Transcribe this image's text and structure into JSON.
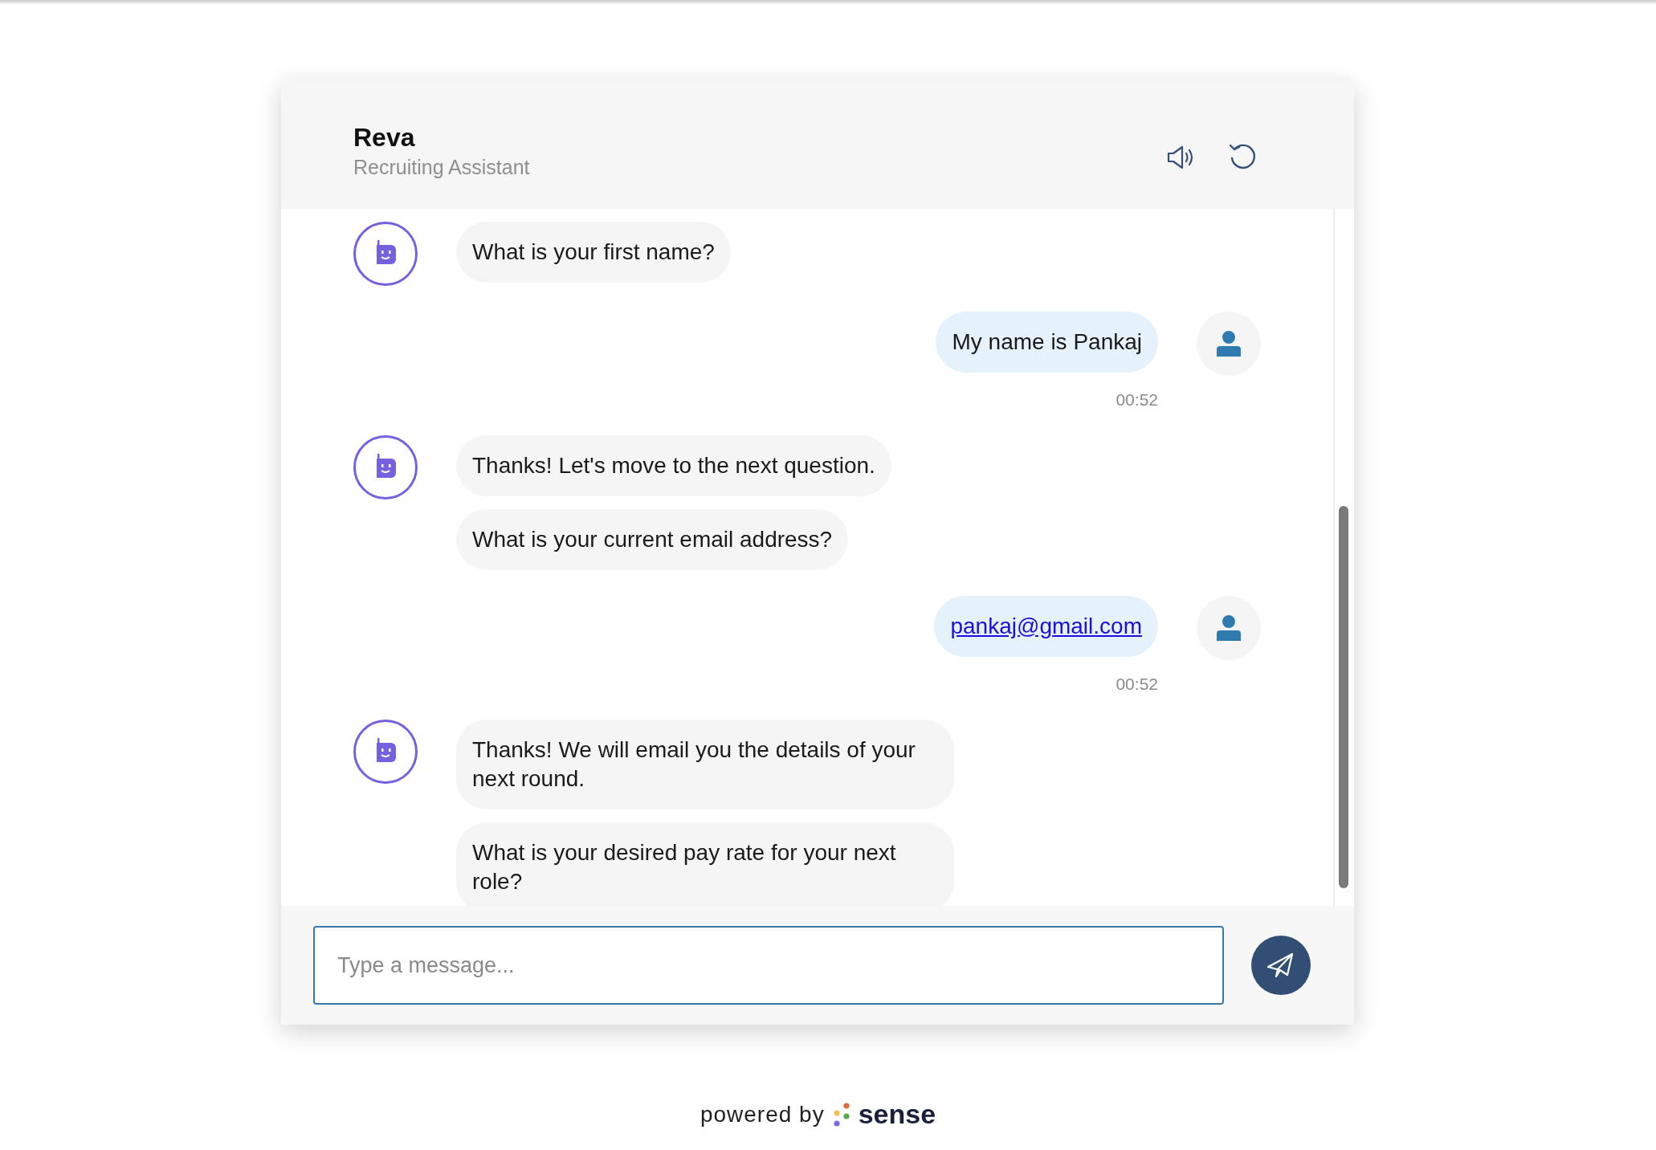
{
  "header": {
    "title": "Reva",
    "subtitle": "Recruiting Assistant"
  },
  "messages": [
    {
      "kind": "bot",
      "bubbles": [
        {
          "kind": "text",
          "text": "What is your first name?"
        }
      ]
    },
    {
      "kind": "user",
      "bubbles": [
        {
          "kind": "text",
          "text": "My name is Pankaj"
        }
      ],
      "time": "00:52"
    },
    {
      "kind": "bot",
      "bubbles": [
        {
          "kind": "text",
          "text": "Thanks! Let's move to the next question."
        },
        {
          "kind": "text",
          "text": "What is your current email address?"
        }
      ]
    },
    {
      "kind": "user",
      "bubbles": [
        {
          "kind": "link",
          "text": "pankaj@gmail.com"
        }
      ],
      "time": "00:52"
    },
    {
      "kind": "bot",
      "bubbles": [
        {
          "kind": "text",
          "text": "Thanks! We will email you the details of your next round."
        },
        {
          "kind": "text",
          "text": "What is your desired pay rate for your next role?"
        }
      ]
    }
  ],
  "composer": {
    "placeholder": "Type a message..."
  },
  "footer": {
    "powered_by": "powered by",
    "brand": "sense"
  }
}
